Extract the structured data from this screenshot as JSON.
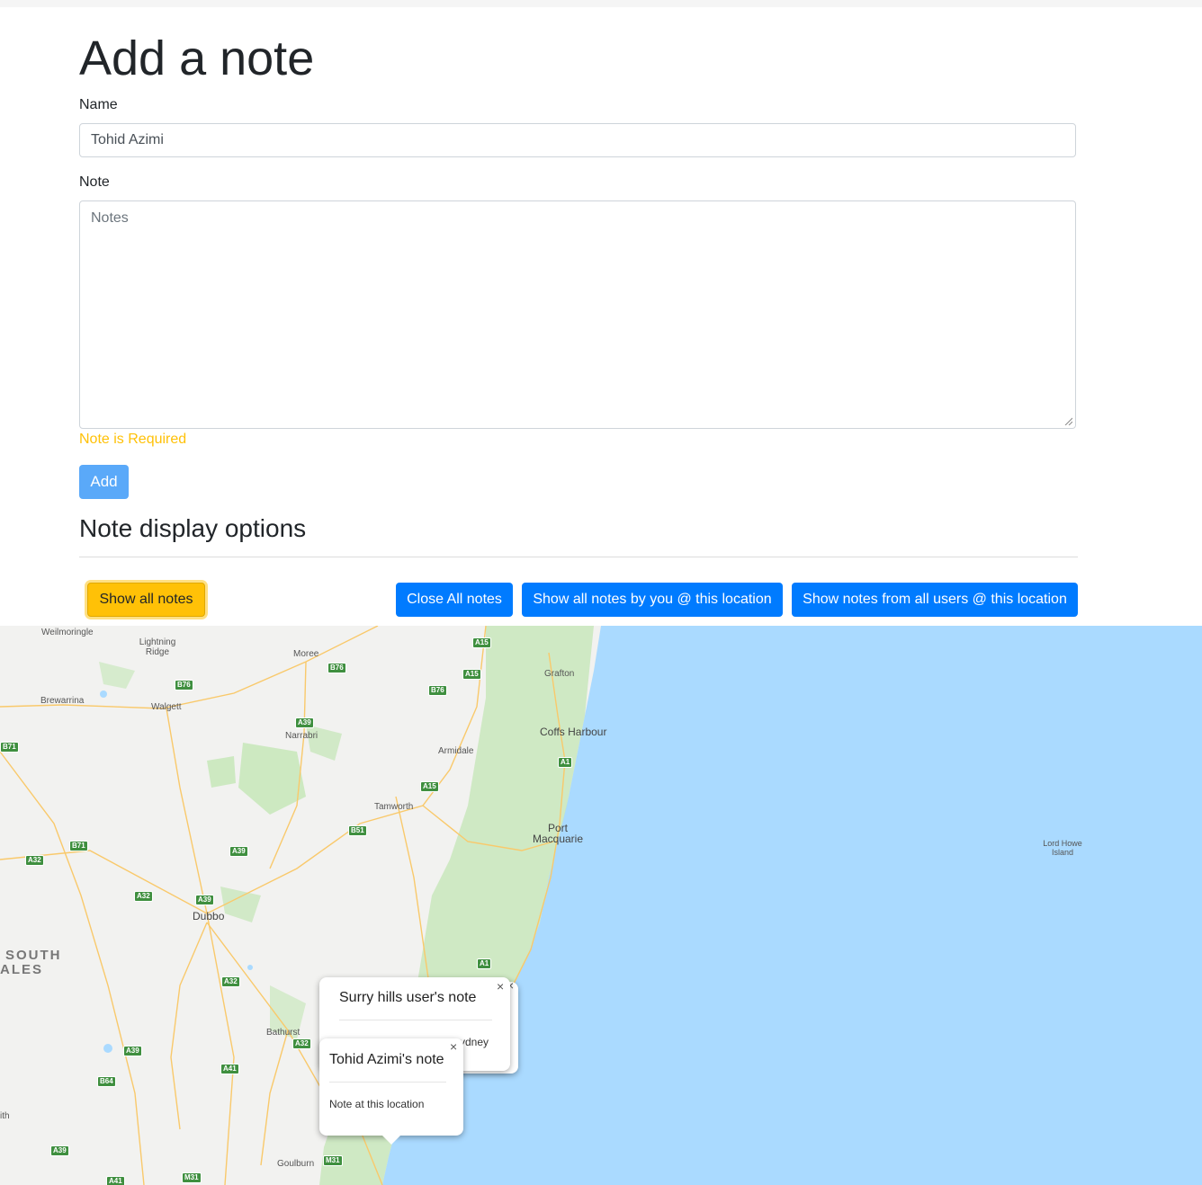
{
  "form": {
    "title": "Add a note",
    "name_label": "Name",
    "name_value": "Tohid Azimi",
    "note_label": "Note",
    "note_placeholder": "Notes",
    "error": "Note is Required",
    "add_label": "Add"
  },
  "options": {
    "heading": "Note display options",
    "show_all": "Show all notes",
    "close_all": "Close All notes",
    "by_you": "Show all notes by you @ this location",
    "all_users": "Show notes from all users @ this location"
  },
  "map": {
    "places": {
      "weilmoringle": "Weilmoringle",
      "lightning_ridge": "Lightning Ridge",
      "moree": "Moree",
      "grafton": "Grafton",
      "brewarrina": "Brewarrina",
      "walgett": "Walgett",
      "narrabri": "Narrabri",
      "armidale": "Armidale",
      "coffs_harbour": "Coffs Harbour",
      "tamworth": "Tamworth",
      "port_macquarie": "Port Macquarie",
      "lord_howe": "Lord Howe Island",
      "dubbo": "Dubbo",
      "bathurst": "Bathurst",
      "goulburn": "Goulburn",
      "region_1": "SOUTH",
      "region_2": "ALES",
      "edge_text": "ith"
    },
    "roads": [
      "A15",
      "B76",
      "A15",
      "B76",
      "B76",
      "B71",
      "A39",
      "A1",
      "A15",
      "B51",
      "B71",
      "A39",
      "A32",
      "A32",
      "A39",
      "A1",
      "A32",
      "A32",
      "A39",
      "A41",
      "B64",
      "A39",
      "A41",
      "M31",
      "M31"
    ],
    "popup_surry": {
      "title": "Surry hills user's note",
      "body_fragment": "ydney",
      "close": "×"
    },
    "popup_tohid": {
      "title": "Tohid Azimi's note",
      "body": "Note at this location",
      "close": "×"
    },
    "colors": {
      "land": "#f2f2f0",
      "water": "#aadaff",
      "park": "#c3e6b5",
      "road": "#f9c96b"
    }
  }
}
